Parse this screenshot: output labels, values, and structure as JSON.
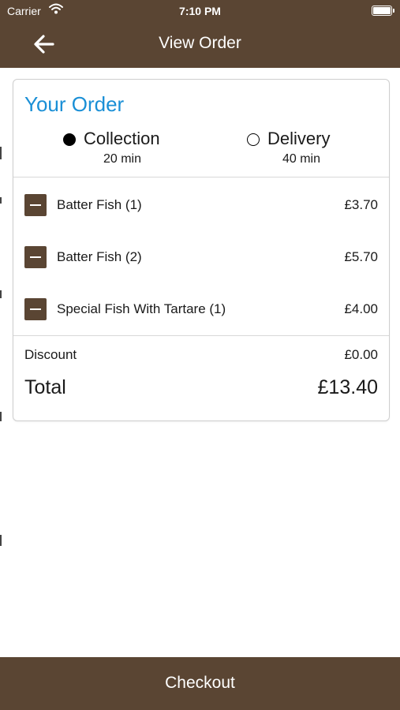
{
  "status_bar": {
    "carrier": "Carrier",
    "time": "7:10 PM"
  },
  "nav": {
    "title": "View Order",
    "back_icon": "arrow-left-icon"
  },
  "order": {
    "heading": "Your Order",
    "options": [
      {
        "label": "Collection",
        "time": "20 min",
        "selected": true
      },
      {
        "label": "Delivery",
        "time": "40 min",
        "selected": false
      }
    ],
    "items": [
      {
        "name": "Batter Fish (1)",
        "price": "£3.70"
      },
      {
        "name": "Batter Fish (2)",
        "price": "£5.70"
      },
      {
        "name": "Special Fish With Tartare (1)",
        "price": "£4.00"
      }
    ],
    "discount_label": "Discount",
    "discount_value": "£0.00",
    "total_label": "Total",
    "total_value": "£13.40"
  },
  "checkout": {
    "label": "Checkout"
  },
  "colors": {
    "brand": "#5a4533",
    "heading": "#1a8fd6"
  }
}
